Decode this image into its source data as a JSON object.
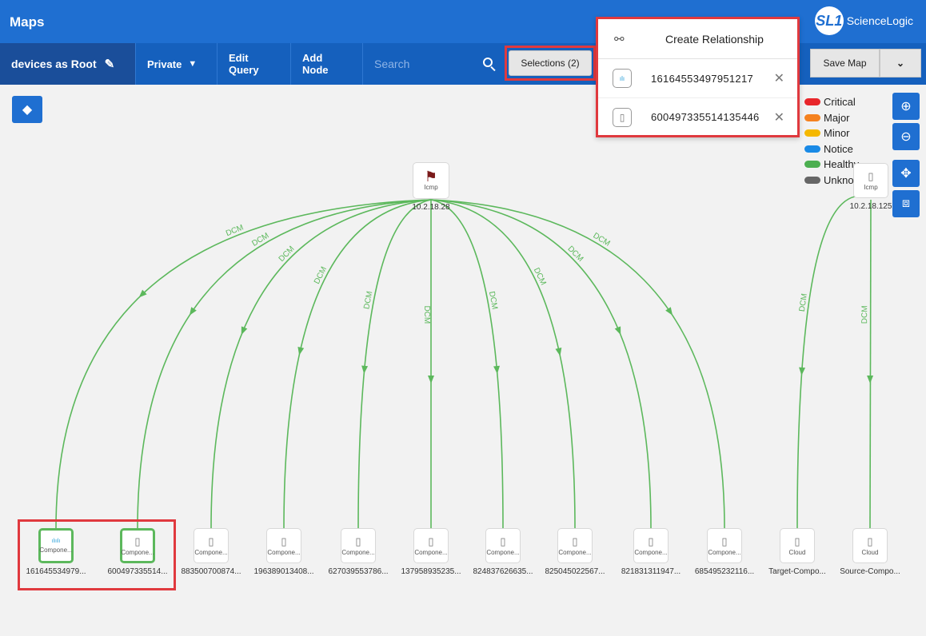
{
  "app": {
    "title": "Maps"
  },
  "logo": {
    "mark": "SL1",
    "text": "ScienceLogic"
  },
  "toolbar": {
    "root_label": "devices as Root",
    "private_label": "Private",
    "edit_query_label": "Edit Query",
    "add_node_label": "Add Node",
    "search_placeholder": "Search",
    "selections_label": "Selections (2)",
    "save_map_label": "Save Map"
  },
  "popup": {
    "title": "Create Relationship",
    "items": [
      {
        "label": "16164553497951217"
      },
      {
        "label": "600497335514135446"
      }
    ]
  },
  "legend": [
    {
      "label": "Critical",
      "color": "#e8262b"
    },
    {
      "label": "Major",
      "color": "#f5821f"
    },
    {
      "label": "Minor",
      "color": "#f5b800"
    },
    {
      "label": "Notice",
      "color": "#1a8ae6"
    },
    {
      "label": "Healthy",
      "color": "#4caf50"
    },
    {
      "label": "Unknown",
      "color": "#666666"
    }
  ],
  "edge_label": "DCM",
  "root_nodes": [
    {
      "type": "Icmp",
      "label": "10.2.18.28"
    },
    {
      "type": "Icmp",
      "label": "10.2.18.125"
    }
  ],
  "child_nodes": [
    {
      "type": "Compone...",
      "label": "161645534979...",
      "selected": true,
      "icon": "cisco"
    },
    {
      "type": "Compone...",
      "label": "600497335514...",
      "selected": true,
      "icon": "device"
    },
    {
      "type": "Compone...",
      "label": "883500700874...",
      "selected": false,
      "icon": "device"
    },
    {
      "type": "Compone...",
      "label": "196389013408...",
      "selected": false,
      "icon": "device"
    },
    {
      "type": "Compone...",
      "label": "627039553786...",
      "selected": false,
      "icon": "device"
    },
    {
      "type": "Compone...",
      "label": "137958935235...",
      "selected": false,
      "icon": "device"
    },
    {
      "type": "Compone...",
      "label": "824837626635...",
      "selected": false,
      "icon": "device"
    },
    {
      "type": "Compone...",
      "label": "825045022567...",
      "selected": false,
      "icon": "device"
    },
    {
      "type": "Compone...",
      "label": "821831311947...",
      "selected": false,
      "icon": "device"
    },
    {
      "type": "Compone...",
      "label": "685495232116...",
      "selected": false,
      "icon": "device"
    },
    {
      "type": "Cloud",
      "label": "Target-Compo...",
      "selected": false,
      "icon": "device"
    },
    {
      "type": "Cloud",
      "label": "Source-Compo...",
      "selected": false,
      "icon": "device"
    }
  ],
  "colors": {
    "edge": "#5cb85c",
    "accent": "#1f6fd1",
    "highlight": "#e0393e"
  }
}
